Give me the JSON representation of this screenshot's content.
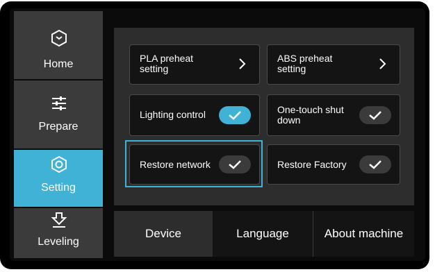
{
  "sidebar": {
    "items": [
      {
        "label": "Home",
        "icon": "home-hex-icon"
      },
      {
        "label": "Prepare",
        "icon": "sliders-icon"
      },
      {
        "label": "Setting",
        "icon": "settings-nut-icon",
        "active": true
      },
      {
        "label": "Leveling",
        "icon": "leveling-icon"
      }
    ]
  },
  "settings": {
    "pla_preheat": {
      "label_line1": "PLA preheat",
      "label_line2": "setting"
    },
    "abs_preheat": {
      "label_line1": "ABS preheat",
      "label_line2": "setting"
    },
    "lighting_control": {
      "label": "Lighting control",
      "enabled": true
    },
    "one_touch_shutdown": {
      "label_line1": "One-touch shut",
      "label_line2": "down",
      "enabled": false
    },
    "restore_network": {
      "label": "Restore network"
    },
    "restore_factory": {
      "label": "Restore Factory"
    }
  },
  "tabs": [
    {
      "label": "Device",
      "active": true
    },
    {
      "label": "Language"
    },
    {
      "label": "About machine"
    }
  ],
  "colors": {
    "accent": "#3fb2d6",
    "panel": "#2d2d2d",
    "sidebar": "#3b3b3b",
    "tile": "#141414"
  }
}
